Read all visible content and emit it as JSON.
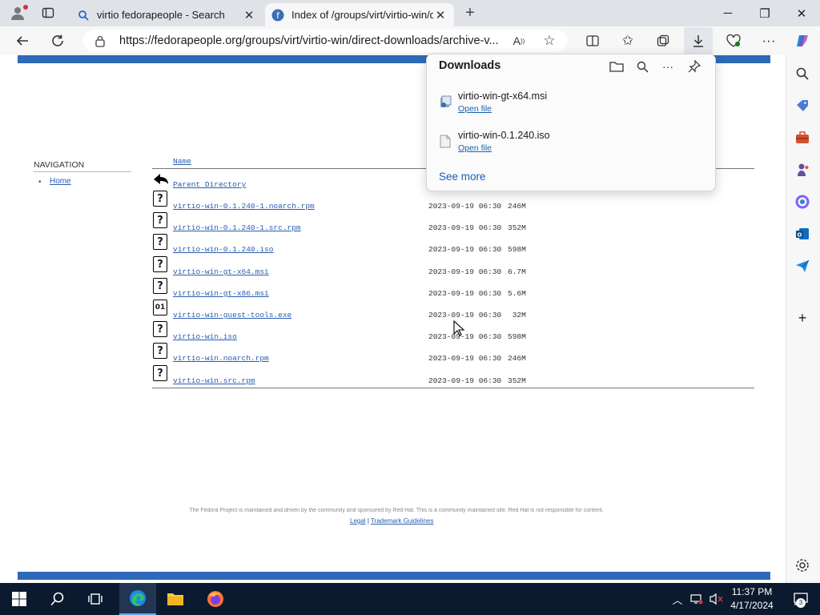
{
  "browser": {
    "tabs": [
      {
        "title": "virtio fedorapeople - Search",
        "active": false,
        "icon": "search-icon"
      },
      {
        "title": "Index of /groups/virt/virtio-win/d",
        "active": true,
        "icon": "fedora-icon"
      }
    ],
    "new_tab": "+",
    "address": "https://fedorapeople.org/groups/virt/virtio-win/direct-downloads/archive-v..."
  },
  "page": {
    "navigation": {
      "heading": "NAVIGATION",
      "items": [
        {
          "label": "Home"
        }
      ]
    },
    "listing": {
      "name_header": "Name",
      "parent": "Parent Directory",
      "rows": [
        {
          "name": "virtio-win-0.1.240-1.noarch.rpm",
          "date": "2023-09-19 06:30",
          "size": "246M",
          "icon": "?"
        },
        {
          "name": "virtio-win-0.1.240-1.src.rpm",
          "date": "2023-09-19 06:30",
          "size": "352M",
          "icon": "?"
        },
        {
          "name": "virtio-win-0.1.240.iso",
          "date": "2023-09-19 06:30",
          "size": "598M",
          "icon": "?"
        },
        {
          "name": "virtio-win-gt-x64.msi",
          "date": "2023-09-19 06:30",
          "size": "6.7M",
          "icon": "?"
        },
        {
          "name": "virtio-win-gt-x86.msi",
          "date": "2023-09-19 06:30",
          "size": "5.6M",
          "icon": "?"
        },
        {
          "name": "virtio-win-guest-tools.exe",
          "date": "2023-09-19 06:30",
          "size": " 32M",
          "icon": "01"
        },
        {
          "name": "virtio-win.iso",
          "date": "2023-09-19 06:30",
          "size": "598M",
          "icon": "?"
        },
        {
          "name": "virtio-win.noarch.rpm",
          "date": "2023-09-19 06:30",
          "size": "246M",
          "icon": "?"
        },
        {
          "name": "virtio-win.src.rpm",
          "date": "2023-09-19 06:30",
          "size": "352M",
          "icon": "?"
        }
      ]
    },
    "footer": {
      "text": "The Fedora Project is maintained and driven by the community and sponsored by Red Hat. This is a community maintained site. Red Hat is not responsible for content.",
      "legal": "Legal",
      "sep": "|",
      "trademark": "Trademark Guidelines"
    }
  },
  "downloads": {
    "title": "Downloads",
    "items": [
      {
        "name": "virtio-win-gt-x64.msi",
        "action": "Open file"
      },
      {
        "name": "virtio-win-0.1.240.iso",
        "action": "Open file"
      }
    ],
    "see_more": "See more"
  },
  "taskbar": {
    "time": "11:37 PM",
    "date": "4/17/2024",
    "notifications": "3"
  }
}
